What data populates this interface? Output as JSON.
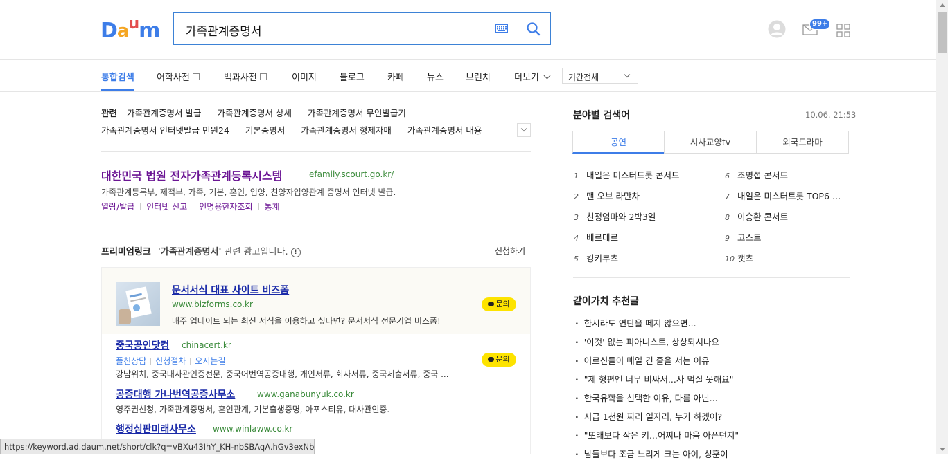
{
  "header": {
    "logo": [
      "D",
      "a",
      "u",
      "m"
    ],
    "logo_colors": [
      "#3d7de8",
      "#f5a623",
      "#e34d4d",
      "#3d7de8"
    ],
    "search_value": "가족관계증명서",
    "mail_badge": "99+"
  },
  "nav": {
    "items": [
      "통합검색",
      "어학사전",
      "백과사전",
      "이미지",
      "블로그",
      "카페",
      "뉴스",
      "브런치",
      "더보기"
    ],
    "period": "기간전체"
  },
  "related": {
    "label": "관련",
    "row1": [
      "가족관계증명서 발급",
      "가족관계증명서 상세",
      "가족관계증명서 무인발급기"
    ],
    "row2": [
      "가족관계증명서 인터넷발급 민원24",
      "기본증명서",
      "가족관계증명서 형제자매",
      "가족관계증명서 내용"
    ]
  },
  "result": {
    "title": "대한민국 법원 전자가족관계등록시스템",
    "url": "efamily.scourt.go.kr/",
    "desc": "가족관계등록부, 제적부, 가족, 기본, 혼인, 입양, 친양자입양관계 증명서 인터넷 발급.",
    "links": [
      "열람/발급",
      "인터넷 신고",
      "인명용한자조회",
      "통계"
    ]
  },
  "premium": {
    "title": "프리미엄링크",
    "keyword": "'가족관계증명서'",
    "suffix": "관련 광고입니다.",
    "info": "!",
    "apply": "신청하기",
    "ads": [
      {
        "title": "문서서식 대표 사이트 비즈폼",
        "url": "www.bizforms.co.kr",
        "desc": "매주 업데이트 되는 최신 서식을 이용하고 싶다면? 문서서식 전문기업 비즈폼!",
        "ask": "문의"
      },
      {
        "title": "중국공인닷컴",
        "url": "chinacert.kr",
        "sub": [
          "플친상담",
          "신청절차",
          "오시는길"
        ],
        "desc": "강남위치, 중국대사관인증전문, 중국어번역공증대행, 개인서류, 회사서류, 중국제출서류, 중국 ...",
        "ask": "문의"
      },
      {
        "title": "공증대행 가나번역공증사무소",
        "url": "www.ganabunyuk.co.kr",
        "desc": "영주권신청, 가족관계증명서, 혼인관계, 기본출생증명, 아포스티유, 대사관인증."
      },
      {
        "title": "행정심판미래사무소",
        "url": "www.winlaww.co.kr"
      }
    ]
  },
  "status_url": "https://keyword.ad.daum.net/short/clk?q=vBXu43IhY_KH-nbSBAqA.hGv3exNbD...",
  "right": {
    "trend_title": "분야별 검색어",
    "time": "10.06. 21:53",
    "tabs": [
      "공연",
      "시사교양tv",
      "외국드라마"
    ],
    "ranks": [
      {
        "n": "1",
        "t": "내일은 미스터트롯 콘서트"
      },
      {
        "n": "2",
        "t": "맨 오브 라만차"
      },
      {
        "n": "3",
        "t": "친정엄마와 2박3일"
      },
      {
        "n": "4",
        "t": "베르테르"
      },
      {
        "n": "5",
        "t": "킹키부츠"
      },
      {
        "n": "6",
        "t": "조명섭 콘서트"
      },
      {
        "n": "7",
        "t": "내일은 미스터트롯 TOP6 …"
      },
      {
        "n": "8",
        "t": "이승환 콘서트"
      },
      {
        "n": "9",
        "t": "고스트"
      },
      {
        "n": "10",
        "t": "캣츠"
      }
    ],
    "rec_title": "같이가치 추천글",
    "rec": [
      "한시라도 연탄을 떼지 않으면...",
      "'이것' 없는 피아니스트, 상상되시나요",
      "어르신들이 매일 긴 줄을 서는 이유",
      "\"제 형편엔 너무 비싸서...사 먹질 못해요\"",
      "한국유학을 선택한 이유, 다름 아닌...",
      "시급 1천원 짜리 일자리, 누가 하겠어?",
      "\"또래보다 작은 키...어찌나 마음 아픈던지\"",
      "남들보다 조금 느리게 크는 아이, 성훈이"
    ]
  }
}
